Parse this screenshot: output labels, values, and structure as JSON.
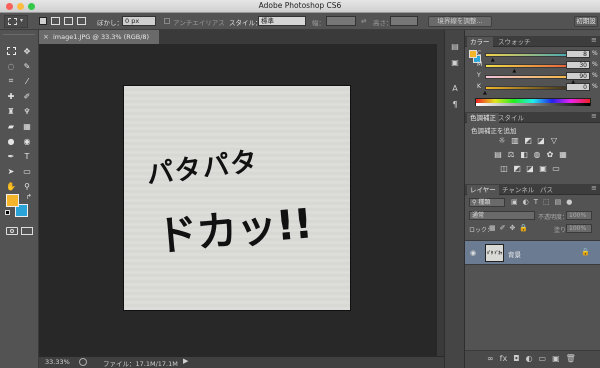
{
  "app": {
    "title": "Adobe Photoshop CS6"
  },
  "options_bar": {
    "feather_label": "ぼかし：",
    "feather_value": "0 px",
    "antialias_label": "アンチエイリアス",
    "style_label": "スタイル：",
    "style_value": "標準",
    "width_label": "幅：",
    "height_label": "高さ：",
    "refine_edge_label": "境界線を調整...",
    "workspace_label": "初期設"
  },
  "document": {
    "tab_label": "image1.JPG @ 33.3% (RGB/8)",
    "zoom": "33.33%",
    "file_info": "ファイル：17.1M/17.1M",
    "art_line1": "パタパタ",
    "art_line2": "ドカッ!!"
  },
  "panels": {
    "color_tabs": [
      "カラー",
      "スウォッチ"
    ],
    "color_sliders": [
      {
        "label": "C",
        "value": "8",
        "pct": 0.08
      },
      {
        "label": "M",
        "value": "30",
        "pct": 0.3
      },
      {
        "label": "Y",
        "value": "90",
        "pct": 0.9
      },
      {
        "label": "K",
        "value": "0",
        "pct": 0.0
      }
    ],
    "percent": "%",
    "adjust_tabs": [
      "色調補正",
      "スタイル"
    ],
    "adjust_add_label": "色調補正を追加",
    "layers_tabs": [
      "レイヤー",
      "チャンネル",
      "パス"
    ],
    "kind_label": "種類",
    "blend_mode": "通常",
    "opacity_label": "不透明度：",
    "opacity_value": "100%",
    "lock_label": "ロック：",
    "fill_label": "塗り：",
    "fill_value": "100%",
    "layer_name": "背景"
  },
  "colors": {
    "foreground": "#f4b52a",
    "background": "#2aa3d8",
    "selected_layer": "#6b7b91"
  }
}
